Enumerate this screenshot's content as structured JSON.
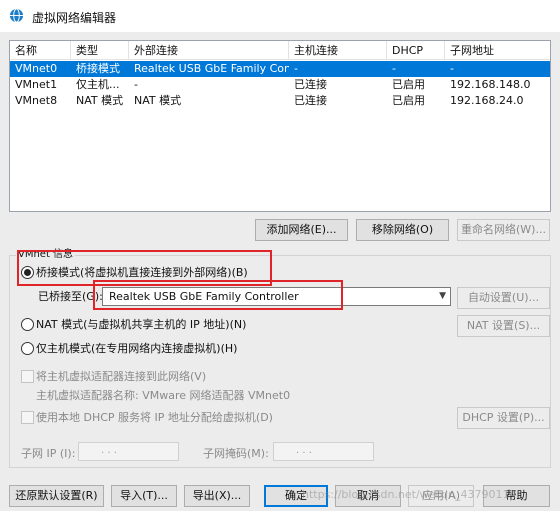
{
  "window": {
    "title": "虚拟网络编辑器"
  },
  "table": {
    "columns": [
      "名称",
      "类型",
      "外部连接",
      "主机连接",
      "DHCP",
      "子网地址"
    ],
    "rows": [
      [
        "VMnet0",
        "桥接模式",
        "Realtek USB GbE Family Contr...",
        "-",
        "-",
        "-"
      ],
      [
        "VMnet1",
        "仅主机...",
        "-",
        "已连接",
        "已启用",
        "192.168.148.0"
      ],
      [
        "VMnet8",
        "NAT 模式",
        "NAT 模式",
        "已连接",
        "已启用",
        "192.168.24.0"
      ]
    ],
    "selected_row": 0
  },
  "table_buttons": {
    "add": "添加网络(E)...",
    "remove": "移除网络(O)",
    "rename": "重命名网络(W)..."
  },
  "vmnet_info": {
    "legend": "VMnet 信息",
    "bridge_radio": "桥接模式(将虚拟机直接连接到外部网络)(B)",
    "bridged_to_label": "已桥接至(G):",
    "bridged_to_value": "Realtek USB GbE Family Controller",
    "auto_settings": "自动设置(U)...",
    "nat_radio": "NAT 模式(与虚拟机共享主机的 IP 地址)(N)",
    "nat_settings": "NAT 设置(S)...",
    "hostonly_radio": "仅主机模式(在专用网络内连接虚拟机)(H)",
    "connect_adapter": "将主机虚拟适配器连接到此网络(V)",
    "adapter_name": "主机虚拟适配器名称: VMware 网络适配器 VMnet0",
    "dhcp_check": "使用本地 DHCP 服务将 IP 地址分配给虚拟机(D)",
    "dhcp_settings": "DHCP 设置(P)...",
    "subnet_ip_label": "子网 IP (I):",
    "subnet_mask_label": "子网掩码(M):",
    "ip_dots": ".    .    .",
    "mode_selected": "bridge"
  },
  "footer": {
    "restore": "还原默认设置(R)",
    "import": "导入(T)...",
    "export": "导出(X)...",
    "ok": "确定",
    "cancel": "取消",
    "apply": "应用(A)",
    "help": "帮助"
  },
  "watermark": "https://blog.csdn.net/weixin_43790114",
  "colors": {
    "selection": "#0078d7",
    "highlight_box": "#e0252a"
  }
}
